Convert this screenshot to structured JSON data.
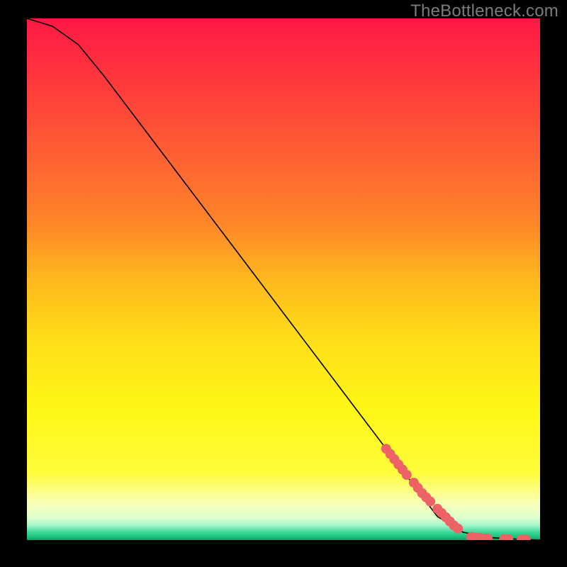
{
  "watermark": "TheBottleneck.com",
  "chart_data": {
    "type": "line",
    "title": "",
    "xlabel": "",
    "ylabel": "",
    "xlim": [
      0,
      1
    ],
    "ylim": [
      0,
      1
    ],
    "curve": {
      "x": [
        0.0,
        0.05,
        0.1,
        0.15,
        0.2,
        0.25,
        0.3,
        0.35,
        0.4,
        0.45,
        0.5,
        0.55,
        0.6,
        0.65,
        0.7,
        0.75,
        0.8,
        0.85,
        0.9,
        0.95,
        1.0
      ],
      "y": [
        1.0,
        0.985,
        0.95,
        0.89,
        0.825,
        0.76,
        0.695,
        0.63,
        0.565,
        0.5,
        0.435,
        0.37,
        0.305,
        0.24,
        0.175,
        0.11,
        0.045,
        0.015,
        0.005,
        0.002,
        0.0
      ]
    },
    "scatter": {
      "x": [
        0.7,
        0.708,
        0.716,
        0.724,
        0.732,
        0.74,
        0.754,
        0.762,
        0.77,
        0.778,
        0.786,
        0.8,
        0.808,
        0.816,
        0.824,
        0.832,
        0.84,
        0.866,
        0.874,
        0.882,
        0.89,
        0.898,
        0.93,
        0.938,
        0.964,
        0.972
      ],
      "y": [
        0.175,
        0.165,
        0.155,
        0.145,
        0.135,
        0.125,
        0.11,
        0.1,
        0.09,
        0.082,
        0.074,
        0.06,
        0.052,
        0.044,
        0.036,
        0.028,
        0.022,
        0.006,
        0.005,
        0.004,
        0.003,
        0.003,
        0.002,
        0.002,
        0.001,
        0.001
      ]
    },
    "gradient_stops": [
      {
        "offset": 0.0,
        "color": "#ff1846"
      },
      {
        "offset": 0.13,
        "color": "#ff3b3b"
      },
      {
        "offset": 0.26,
        "color": "#ff5f33"
      },
      {
        "offset": 0.39,
        "color": "#ff8529"
      },
      {
        "offset": 0.5,
        "color": "#ffb81d"
      },
      {
        "offset": 0.62,
        "color": "#ffdf18"
      },
      {
        "offset": 0.75,
        "color": "#fff716"
      },
      {
        "offset": 0.87,
        "color": "#fffc3a"
      },
      {
        "offset": 0.93,
        "color": "#f9ffb8"
      },
      {
        "offset": 0.958,
        "color": "#dcffcc"
      },
      {
        "offset": 0.972,
        "color": "#a2f5cb"
      },
      {
        "offset": 0.985,
        "color": "#3bd998"
      },
      {
        "offset": 0.995,
        "color": "#17bd78"
      },
      {
        "offset": 1.0,
        "color": "#0f9e60"
      }
    ],
    "scatter_color": "#ed6265",
    "curve_color": "#000000"
  }
}
